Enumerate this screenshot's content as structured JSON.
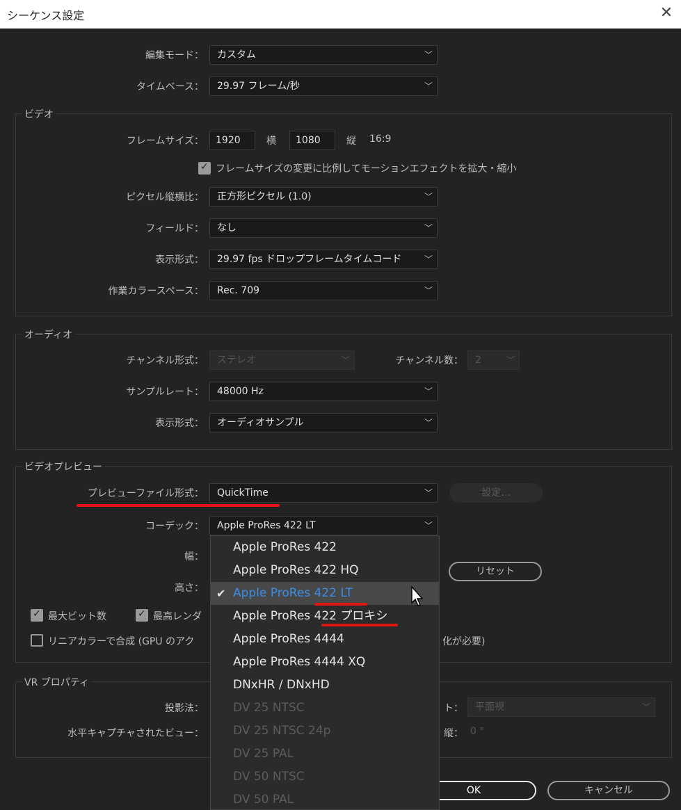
{
  "window": {
    "title": "シーケンス設定",
    "close_icon": "close-icon"
  },
  "general": {
    "edit_mode": {
      "label": "編集モード：",
      "value": "カスタム"
    },
    "timebase": {
      "label": "タイムベース：",
      "value": "29.97  フレーム/秒"
    }
  },
  "video": {
    "title": "ビデオ",
    "frame_size": {
      "label": "フレームサイズ：",
      "width": "1920",
      "width_unit": "横",
      "height": "1080",
      "height_unit": "縦",
      "aspect": "16:9"
    },
    "scale_checkbox": {
      "label": "フレームサイズの変更に比例してモーションエフェクトを拡大・縮小",
      "checked": true
    },
    "pixel_aspect": {
      "label": "ピクセル縦横比：",
      "value": "正方形ピクセル (1.0)"
    },
    "field": {
      "label": "フィールド：",
      "value": "なし"
    },
    "display_format": {
      "label": "表示形式：",
      "value": "29.97  fps ドロップフレームタイムコード"
    },
    "color_space": {
      "label": "作業カラースペース：",
      "value": "Rec. 709"
    }
  },
  "audio": {
    "title": "オーディオ",
    "channel_format": {
      "label": "チャンネル形式：",
      "value": "ステレオ"
    },
    "channel_count": {
      "label": "チャンネル数：",
      "value": "2"
    },
    "sample_rate": {
      "label": "サンプルレート：",
      "value": "48000 Hz"
    },
    "display_format": {
      "label": "表示形式：",
      "value": "オーディオサンプル"
    }
  },
  "video_preview": {
    "title": "ビデオプレビュー",
    "preview_format": {
      "label": "プレビューファイル形式：",
      "value": "QuickTime"
    },
    "settings_button": "設定...",
    "codec": {
      "label": "コーデック：",
      "value": "Apple ProRes 422 LT"
    },
    "width_label": "幅：",
    "height_label": "高さ：",
    "reset_button": "リセット",
    "max_bit_depth": {
      "label": "最大ビット数",
      "checked": true
    },
    "max_render": {
      "label": "最高レンダ",
      "checked": true
    },
    "linear_color": {
      "label": "リニアカラーで合成 (GPU のアク",
      "suffix": "化が必要)",
      "checked": false
    }
  },
  "vr": {
    "title": "VR プロパティ",
    "projection_label": "投影法：",
    "layout_label_suffix": "ト：",
    "layout_value": "平面視",
    "capture_label": "水平キャプチャされたビュー：",
    "vertical_label": "縦：",
    "vertical_value": "0 °"
  },
  "codec_menu": {
    "items": [
      {
        "label": "Apple ProRes 422",
        "state": "normal"
      },
      {
        "label": "Apple ProRes 422 HQ",
        "state": "normal"
      },
      {
        "label": "Apple ProRes 422 LT",
        "state": "selected"
      },
      {
        "label": "Apple  ProRes  422 プロキシ",
        "state": "normal"
      },
      {
        "label": "Apple ProRes 4444",
        "state": "normal"
      },
      {
        "label": "Apple ProRes 4444 XQ",
        "state": "normal"
      },
      {
        "label": "DNxHR / DNxHD",
        "state": "normal"
      },
      {
        "label": "DV 25 NTSC",
        "state": "disabled"
      },
      {
        "label": "DV 25 NTSC 24p",
        "state": "disabled"
      },
      {
        "label": "DV 25 PAL",
        "state": "disabled"
      },
      {
        "label": "DV 50 NTSC",
        "state": "disabled"
      },
      {
        "label": "DV 50 PAL",
        "state": "disabled"
      }
    ]
  },
  "footer": {
    "ok_button": "OK",
    "cancel_button": "キャンセル"
  },
  "colors": {
    "annotation": "#e01515",
    "selected_text": "#3b8ee6",
    "background": "#232323"
  }
}
